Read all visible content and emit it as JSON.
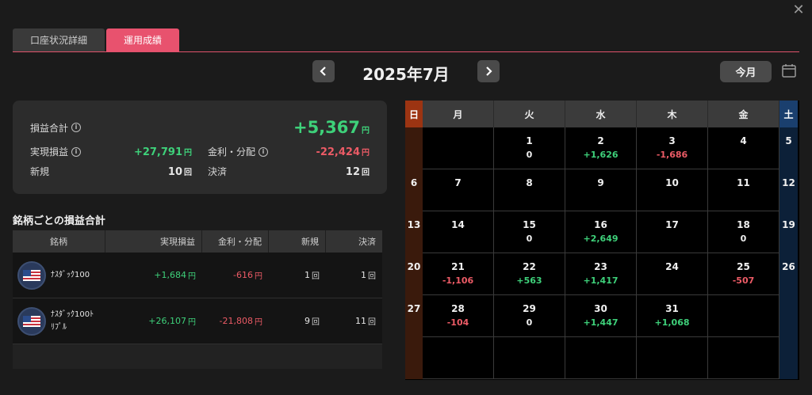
{
  "tabs": [
    {
      "label": "口座状況詳細",
      "active": false
    },
    {
      "label": "運用成績",
      "active": true
    }
  ],
  "month_nav": {
    "title": "2025年7月",
    "today_label": "今月"
  },
  "summary": {
    "total_label": "損益合計",
    "total_value": "+5,367",
    "realized_label": "実現損益",
    "realized_value": "+27,791",
    "interest_label": "金利・分配",
    "interest_value": "-22,424",
    "new_label": "新規",
    "new_value": "10",
    "settle_label": "決済",
    "settle_value": "12",
    "yen": "円",
    "kai": "回"
  },
  "stock_section": {
    "title": "銘柄ごとの損益合計",
    "headers": [
      "銘柄",
      "実現損益",
      "金利・分配",
      "新規",
      "決済"
    ],
    "rows": [
      {
        "name": "ﾅｽﾀﾞｯｸ100",
        "realized": "+1,684",
        "interest": "-616",
        "new": "1",
        "settle": "1"
      },
      {
        "name_line1": "ﾅｽﾀﾞｯｸ100ﾄ",
        "name_line2": "ﾘﾌﾟﾙ",
        "realized": "+26,107",
        "interest": "-21,808",
        "new": "9",
        "settle": "11"
      }
    ]
  },
  "calendar": {
    "weekdays": [
      "日",
      "月",
      "火",
      "水",
      "木",
      "金",
      "土"
    ],
    "weeks": [
      [
        {
          "d": ""
        },
        {
          "d": ""
        },
        {
          "d": "1",
          "v": "0"
        },
        {
          "d": "2",
          "v": "+1,626"
        },
        {
          "d": "3",
          "v": "-1,686"
        },
        {
          "d": "4"
        },
        {
          "d": "5"
        }
      ],
      [
        {
          "d": "6"
        },
        {
          "d": "7"
        },
        {
          "d": "8"
        },
        {
          "d": "9"
        },
        {
          "d": "10"
        },
        {
          "d": "11"
        },
        {
          "d": "12"
        }
      ],
      [
        {
          "d": "13"
        },
        {
          "d": "14"
        },
        {
          "d": "15",
          "v": "0"
        },
        {
          "d": "16",
          "v": "+2,649"
        },
        {
          "d": "17"
        },
        {
          "d": "18",
          "v": "0"
        },
        {
          "d": "19"
        }
      ],
      [
        {
          "d": "20"
        },
        {
          "d": "21",
          "v": "-1,106"
        },
        {
          "d": "22",
          "v": "+563"
        },
        {
          "d": "23",
          "v": "+1,417"
        },
        {
          "d": "24"
        },
        {
          "d": "25",
          "v": "-507"
        },
        {
          "d": "26"
        }
      ],
      [
        {
          "d": "27"
        },
        {
          "d": "28",
          "v": "-104"
        },
        {
          "d": "29",
          "v": "0"
        },
        {
          "d": "30",
          "v": "+1,447"
        },
        {
          "d": "31",
          "v": "+1,068"
        },
        {
          "d": ""
        },
        {
          "d": ""
        }
      ],
      [
        {
          "d": ""
        },
        {
          "d": ""
        },
        {
          "d": ""
        },
        {
          "d": ""
        },
        {
          "d": ""
        },
        {
          "d": ""
        },
        {
          "d": ""
        }
      ]
    ]
  },
  "colors": {
    "positive": "#3ed17a",
    "negative": "#ec5b66",
    "accent": "#e8526e"
  }
}
